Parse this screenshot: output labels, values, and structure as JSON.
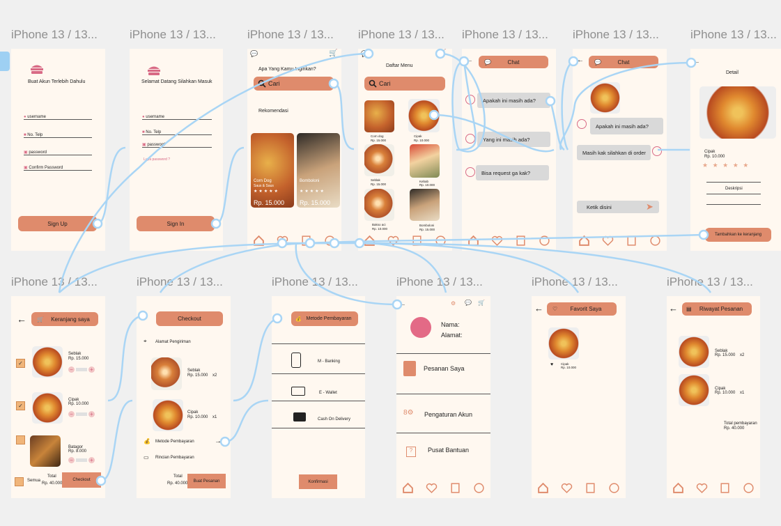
{
  "frame_label": "iPhone 13 / 13...",
  "colors": {
    "accent": "#df8b6c",
    "background": "#fff8f0",
    "wire": "#a9d5f5",
    "icon_pink": "#d86a85"
  },
  "signup": {
    "title": "Buat Akun Terlebih Dahulu",
    "fields": [
      "username",
      "No. Telp",
      "password",
      "Confirm Password"
    ],
    "button": "Sign Up"
  },
  "signin": {
    "title": "Selamat Datang Silahkan Masuk",
    "fields": [
      "username",
      "No. Telp",
      "password"
    ],
    "forgot": "Lupa password ?",
    "button": "Sign In"
  },
  "home": {
    "question": "Apa Yang Kamu Inginkan?",
    "search_placeholder": "Cari",
    "section": "Rekomendasi",
    "cards": [
      {
        "name": "Corn Dog",
        "desc": "Saus & Saus",
        "price": "Rp. 15.000"
      },
      {
        "name": "Bomboloni",
        "price": "Rp. 15.000"
      }
    ]
  },
  "menu": {
    "title": "Daftar Menu",
    "search_placeholder": "Cari",
    "items": [
      {
        "name": "Corn dog",
        "price": "Rp. 15.000"
      },
      {
        "name": "Cipak",
        "price": "Rp. 10.000"
      },
      {
        "name": "Seblak",
        "price": "Rp. 15.000"
      },
      {
        "name": "Kebab",
        "price": "Rp. 10.000"
      },
      {
        "name": "Bakso aci",
        "price": "Rp. 10.000"
      },
      {
        "name": "Bomboloni",
        "price": "Rp. 15.000"
      }
    ]
  },
  "chat1": {
    "title": "Chat",
    "messages": [
      "Apakah ini masih ada?",
      "Yang ini masih ada?",
      "Bisa request ga kak?"
    ]
  },
  "chat2": {
    "title": "Chat",
    "messages": [
      "Apakah ini masih ada?",
      "Masih kak silahkan di order"
    ],
    "input_placeholder": "Ketik disini"
  },
  "detail": {
    "title": "Detail",
    "name": "Cipak",
    "price": "Rp. 10.000",
    "stars": "★ ★ ★ ★ ★",
    "desc_label": "Deskripsi",
    "button": "Tambahkan ke keranjang"
  },
  "cart": {
    "title": "Keranjang saya",
    "items": [
      {
        "name": "Seblak",
        "price": "Rp. 15.000"
      },
      {
        "name": "Cipak",
        "price": "Rp. 10.000"
      },
      {
        "name": "Batagor",
        "price": "Rp. 8.000"
      }
    ],
    "check": "✓",
    "select_all": "Semua",
    "total_label": "Total",
    "total": "Rp. 40.000",
    "button": "Checkout"
  },
  "checkout": {
    "title": "Checkout",
    "address": "Alamat Pengiriman",
    "items": [
      {
        "name": "Seblak",
        "price": "Rp. 15.000",
        "qty": "x2"
      },
      {
        "name": "Cipak",
        "price": "Rp. 10.000",
        "qty": "x1"
      }
    ],
    "payment_method": "Metode Pembayaran",
    "payment_detail": "Rincian Pembayaran",
    "total_label": "Total",
    "total": "Rp. 40.000",
    "button": "Buat Pesanan"
  },
  "payment": {
    "title": "Metode Pembayaran",
    "options": [
      "M - Banking",
      "E - Wallet",
      "Cash On Delivery"
    ],
    "button": "Konfirmasi"
  },
  "profile": {
    "name_label": "Nama:",
    "address_label": "Alamat:",
    "menu": [
      "Pesanan Saya",
      "Pengaturan Akun",
      "Pusat Bantuan"
    ]
  },
  "favorite": {
    "title": "Favorit Saya",
    "item": {
      "name": "Cipak",
      "price": "Rp. 10.000"
    }
  },
  "history": {
    "title": "Riwayat Pesanan",
    "items": [
      {
        "name": "Seblak",
        "price": "Rp. 15.000",
        "qty": "x2"
      },
      {
        "name": "Cipak",
        "price": "Rp. 10.000",
        "qty": "x1"
      }
    ],
    "total_label": "Total pembayaran",
    "total": "Rp. 40.000"
  }
}
